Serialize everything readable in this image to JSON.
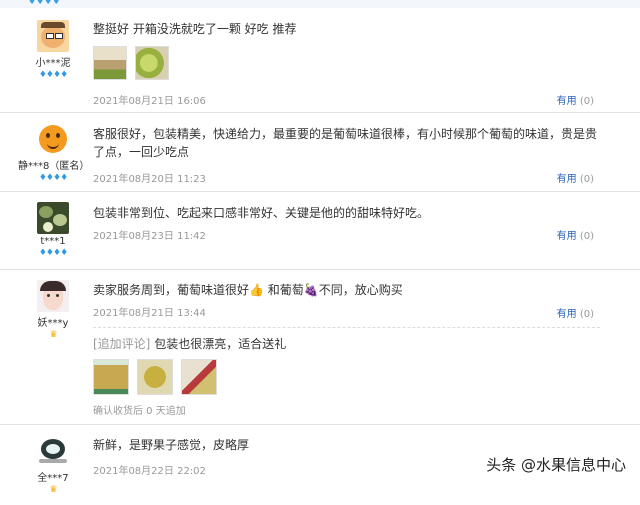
{
  "diamond": "♦♦♦♦",
  "crown": "♛",
  "reviews": [
    {
      "user": "小***泥",
      "text": "整挺好 开箱没洗就吃了一颗 好吃 推荐",
      "date": "2021年08月21日 16:06",
      "useful_label": "有用",
      "useful_count": "(0)"
    },
    {
      "user": "静***8（匿名）",
      "text": "客服很好，包装精美，快递给力，最重要的是葡萄味道很棒，有小时候那个葡萄的味道，贵是贵了点，一回少吃点",
      "date": "2021年08月20日 11:23",
      "useful_label": "有用",
      "useful_count": "(0)"
    },
    {
      "user": "t***1",
      "text": "包装非常到位、吃起来口感非常好、关键是他的的甜味特好吃。",
      "date": "2021年08月23日 11:42",
      "useful_label": "有用",
      "useful_count": "(0)"
    },
    {
      "user": "妖***y",
      "text": "卖家服务周到，葡萄味道很好👍 和葡萄🍇不同，放心购买",
      "date": "2021年08月21日 13:44",
      "useful_label": "有用",
      "useful_count": "(0)",
      "append_label": "[追加评论]",
      "append_text": "包装也很漂亮，适合送礼",
      "confirm": "确认收货后 0 天追加"
    },
    {
      "user": "全***7",
      "text": "新鲜，是野果子感觉，皮略厚",
      "date": "2021年08月22日 22:02"
    }
  ],
  "watermark": {
    "brand": "头条 @水果信息中心"
  }
}
